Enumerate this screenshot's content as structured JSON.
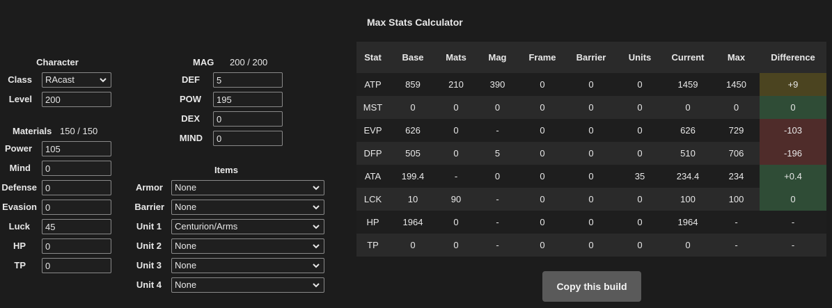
{
  "calculator": {
    "title": "Max Stats Calculator"
  },
  "character": {
    "header": "Character",
    "class_label": "Class",
    "class_value": "RAcast",
    "level_label": "Level",
    "level_value": "200"
  },
  "materials": {
    "header": "Materials",
    "count": "150 / 150",
    "items": [
      {
        "label": "Power",
        "value": "105"
      },
      {
        "label": "Mind",
        "value": "0"
      },
      {
        "label": "Defense",
        "value": "0"
      },
      {
        "label": "Evasion",
        "value": "0"
      },
      {
        "label": "Luck",
        "value": "45"
      },
      {
        "label": "HP",
        "value": "0"
      },
      {
        "label": "TP",
        "value": "0"
      }
    ]
  },
  "mag": {
    "header": "MAG",
    "count": "200 / 200",
    "items": [
      {
        "label": "DEF",
        "value": "5"
      },
      {
        "label": "POW",
        "value": "195"
      },
      {
        "label": "DEX",
        "value": "0"
      },
      {
        "label": "MIND",
        "value": "0"
      }
    ]
  },
  "items": {
    "header": "Items",
    "slots": [
      {
        "label": "Armor",
        "value": "None"
      },
      {
        "label": "Barrier",
        "value": "None"
      },
      {
        "label": "Unit 1",
        "value": "Centurion/Arms"
      },
      {
        "label": "Unit 2",
        "value": "None"
      },
      {
        "label": "Unit 3",
        "value": "None"
      },
      {
        "label": "Unit 4",
        "value": "None"
      }
    ]
  },
  "table": {
    "headers": [
      "Stat",
      "Base",
      "Mats",
      "Mag",
      "Frame",
      "Barrier",
      "Units",
      "Current",
      "Max",
      "Difference"
    ],
    "rows": [
      {
        "cells": [
          "ATP",
          "859",
          "210",
          "390",
          "0",
          "0",
          "0",
          "1459",
          "1450",
          "+9"
        ],
        "status": "warn"
      },
      {
        "cells": [
          "MST",
          "0",
          "0",
          "0",
          "0",
          "0",
          "0",
          "0",
          "0",
          "0"
        ],
        "status": "ok"
      },
      {
        "cells": [
          "EVP",
          "626",
          "0",
          "-",
          "0",
          "0",
          "0",
          "626",
          "729",
          "-103"
        ],
        "status": "bad"
      },
      {
        "cells": [
          "DFP",
          "505",
          "0",
          "5",
          "0",
          "0",
          "0",
          "510",
          "706",
          "-196"
        ],
        "status": "bad"
      },
      {
        "cells": [
          "ATA",
          "199.4",
          "-",
          "0",
          "0",
          "0",
          "35",
          "234.4",
          "234",
          "+0.4"
        ],
        "status": "ok"
      },
      {
        "cells": [
          "LCK",
          "10",
          "90",
          "-",
          "0",
          "0",
          "0",
          "100",
          "100",
          "0"
        ],
        "status": "ok"
      },
      {
        "cells": [
          "HP",
          "1964",
          "0",
          "-",
          "0",
          "0",
          "0",
          "1964",
          "-",
          "-"
        ],
        "status": "none"
      },
      {
        "cells": [
          "TP",
          "0",
          "0",
          "-",
          "0",
          "0",
          "0",
          "0",
          "-",
          "-"
        ],
        "status": "none"
      }
    ]
  },
  "actions": {
    "copy_label": "Copy this build"
  },
  "colors": {
    "background": "#1c1c1c",
    "diff_warn": "#4b4420",
    "diff_ok": "#2f4c36",
    "diff_bad": "#4f2c2a",
    "button": "#5a5a5a"
  },
  "icons": {
    "dropdown": "chevron-down-icon"
  }
}
